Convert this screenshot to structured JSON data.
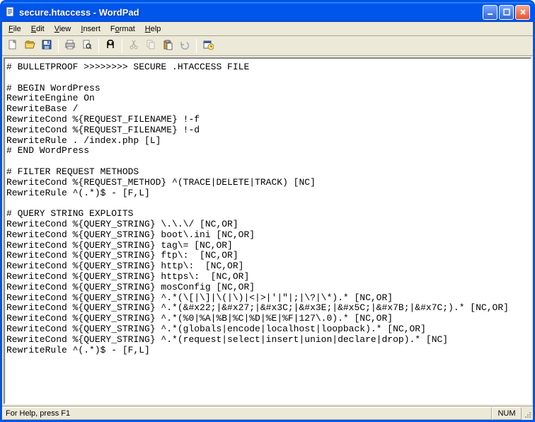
{
  "window": {
    "title": "secure.htaccess - WordPad"
  },
  "menu": {
    "file": "File",
    "edit": "Edit",
    "view": "View",
    "insert": "Insert",
    "format": "Format",
    "help": "Help"
  },
  "toolbar_icons": {
    "new": "new-file-icon",
    "open": "open-folder-icon",
    "save": "save-icon",
    "print": "print-icon",
    "preview": "print-preview-icon",
    "find": "find-icon",
    "cut": "cut-icon",
    "copy": "copy-icon",
    "paste": "paste-icon",
    "undo": "undo-icon",
    "datetime": "datetime-icon"
  },
  "document": {
    "content": "# BULLETPROOF >>>>>>>> SECURE .HTACCESS FILE\n\n# BEGIN WordPress\nRewriteEngine On\nRewriteBase /\nRewriteCond %{REQUEST_FILENAME} !-f\nRewriteCond %{REQUEST_FILENAME} !-d\nRewriteRule . /index.php [L]\n# END WordPress\n\n# FILTER REQUEST METHODS\nRewriteCond %{REQUEST_METHOD} ^(TRACE|DELETE|TRACK) [NC]\nRewriteRule ^(.*)$ - [F,L]\n\n# QUERY STRING EXPLOITS\nRewriteCond %{QUERY_STRING} \\.\\.\\/ [NC,OR]\nRewriteCond %{QUERY_STRING} boot\\.ini [NC,OR]\nRewriteCond %{QUERY_STRING} tag\\= [NC,OR]\nRewriteCond %{QUERY_STRING} ftp\\:  [NC,OR]\nRewriteCond %{QUERY_STRING} http\\:  [NC,OR]\nRewriteCond %{QUERY_STRING} https\\:  [NC,OR]\nRewriteCond %{QUERY_STRING} mosConfig [NC,OR]\nRewriteCond %{QUERY_STRING} ^.*(\\[|\\]|\\(|\\)|<|>|'|\"|;|\\?|\\*).* [NC,OR]\nRewriteCond %{QUERY_STRING} ^.*(&#x22;|&#x27;|&#x3C;|&#x3E;|&#x5C;|&#x7B;|&#x7C;).* [NC,OR]\nRewriteCond %{QUERY_STRING} ^.*(%0|%A|%B|%C|%D|%E|%F|127\\.0).* [NC,OR]\nRewriteCond %{QUERY_STRING} ^.*(globals|encode|localhost|loopback).* [NC,OR]\nRewriteCond %{QUERY_STRING} ^.*(request|select|insert|union|declare|drop).* [NC]\nRewriteRule ^(.*)$ - [F,L]"
  },
  "statusbar": {
    "help": "For Help, press F1",
    "num": "NUM"
  }
}
